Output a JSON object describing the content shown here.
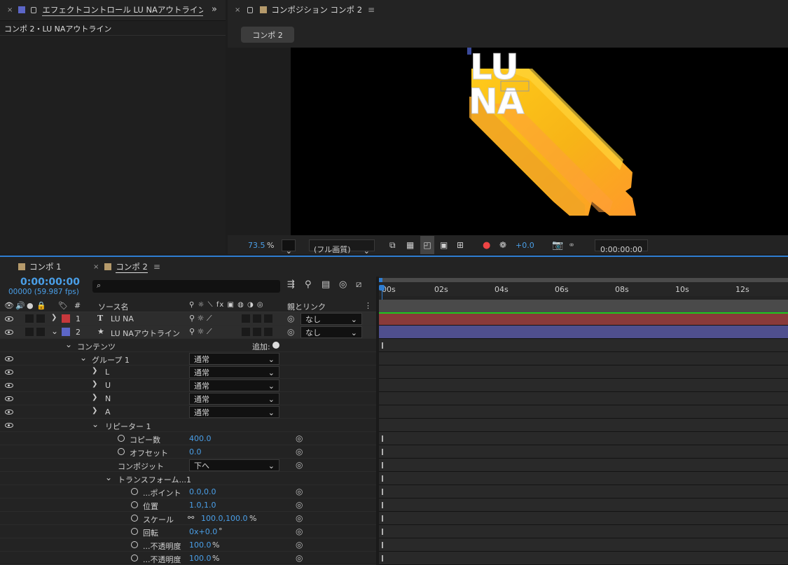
{
  "effect_panel": {
    "tab_title": "エフェクトコントロール LU NAアウトライン",
    "subtitle": "コンポ 2・LU NAアウトライン",
    "more": "»"
  },
  "comp_panel": {
    "tab_title": "コンポジション コンポ 2",
    "comp_button": "コンポ 2",
    "viewer_text": [
      "LU",
      "NA"
    ],
    "zoom": "73.5",
    "zoom_unit": "%",
    "quality": "(フル画質)",
    "exposure": "+0.0",
    "timecode": "0:00:00:00"
  },
  "timeline": {
    "tabs": [
      {
        "label": "コンポ 1",
        "color": "#b59a6b",
        "active": false
      },
      {
        "label": "コンポ 2",
        "color": "#b59a6b",
        "active": true
      }
    ],
    "current_time": "0:00:00:00",
    "frame_info": "00000 (59.987 fps)",
    "search_placeholder": "",
    "headers": {
      "num": "#",
      "source": "ソース名",
      "parent": "親とリンク"
    },
    "ruler": [
      "00s",
      "02s",
      "04s",
      "06s",
      "08s",
      "10s",
      "12s"
    ],
    "layers": [
      {
        "num": "1",
        "type_icon": "T",
        "name": "LU NA",
        "color": "#c7383c",
        "parent": "なし",
        "bar_color": "#8a3a3a"
      },
      {
        "num": "2",
        "type_icon": "★",
        "name": "LU NAアウトライン",
        "color": "#5c66c7",
        "parent": "なし",
        "bar_color": "#4f4f8e"
      }
    ],
    "props": {
      "contents": "コンテンツ",
      "add": "追加:",
      "group": "グループ 1",
      "group_mode": "通常",
      "sub": [
        {
          "label": "L",
          "mode": "通常"
        },
        {
          "label": "U",
          "mode": "通常"
        },
        {
          "label": "N",
          "mode": "通常"
        },
        {
          "label": "A",
          "mode": "通常"
        }
      ],
      "repeater": "リピーター 1",
      "copies_label": "コピー数",
      "copies": "400.0",
      "offset_label": "オフセット",
      "offset": "0.0",
      "composite_label": "コンポジット",
      "composite": "下へ",
      "transform": "トランスフォーム...1",
      "anchor_label": "...ポイント",
      "anchor": "0.0,0.0",
      "position_label": "位置",
      "position": "1.0,1.0",
      "scale_label": "スケール",
      "scale": "100.0,100.0",
      "scale_unit": "%",
      "rotation_label": "回転",
      "rotation": "0x+0.0",
      "rotation_unit": "°",
      "start_op_label": "...不透明度",
      "start_op": "100.0",
      "end_op_label": "...不透明度",
      "end_op": "100.0",
      "op_unit": "%"
    }
  },
  "colors": {
    "accent": "#4a9fe8",
    "workarea": "#2e7dd1",
    "green_line": "#1ec81e",
    "luna_gold": "#f5b400"
  }
}
